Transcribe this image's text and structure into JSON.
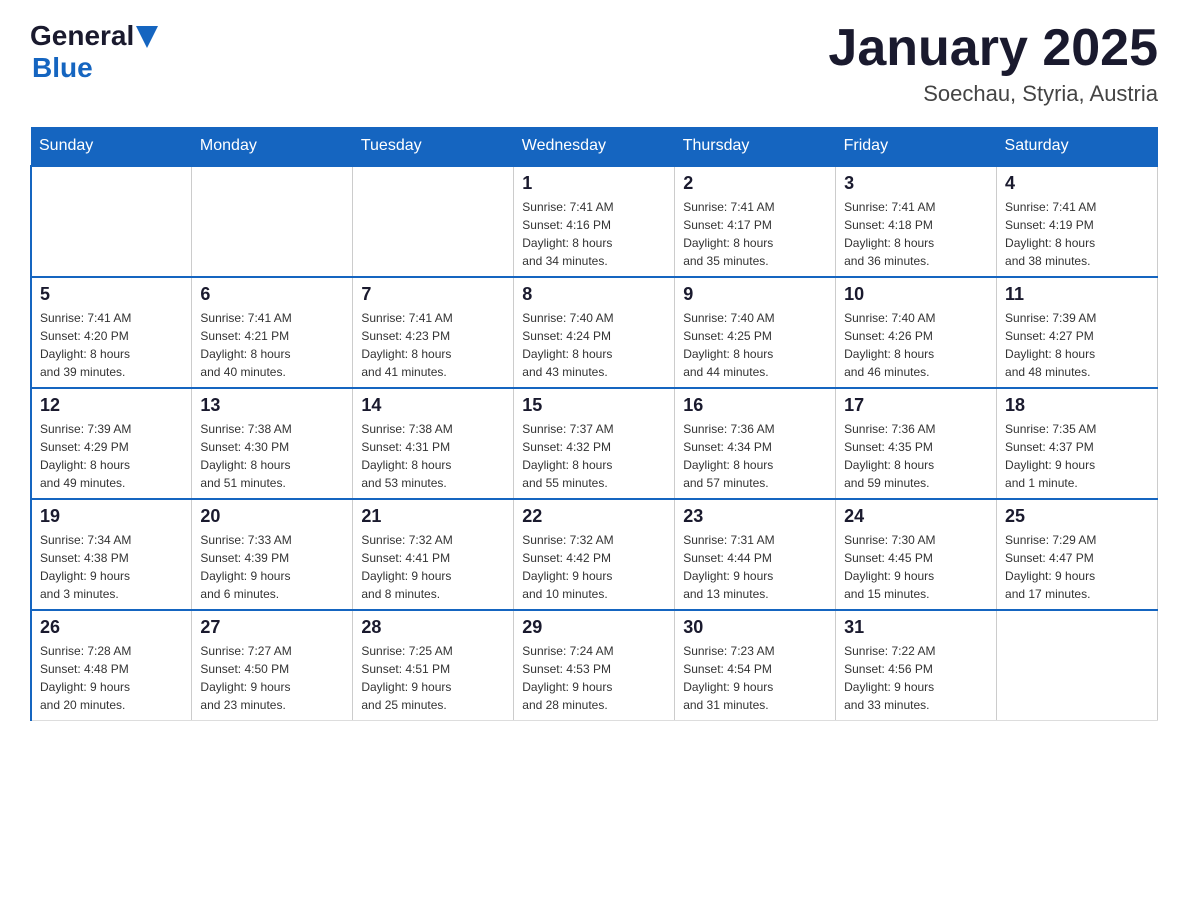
{
  "header": {
    "logo_general": "General",
    "logo_blue": "Blue",
    "title": "January 2025",
    "subtitle": "Soechau, Styria, Austria"
  },
  "days_of_week": [
    "Sunday",
    "Monday",
    "Tuesday",
    "Wednesday",
    "Thursday",
    "Friday",
    "Saturday"
  ],
  "weeks": [
    [
      {
        "day": "",
        "info": ""
      },
      {
        "day": "",
        "info": ""
      },
      {
        "day": "",
        "info": ""
      },
      {
        "day": "1",
        "info": "Sunrise: 7:41 AM\nSunset: 4:16 PM\nDaylight: 8 hours\nand 34 minutes."
      },
      {
        "day": "2",
        "info": "Sunrise: 7:41 AM\nSunset: 4:17 PM\nDaylight: 8 hours\nand 35 minutes."
      },
      {
        "day": "3",
        "info": "Sunrise: 7:41 AM\nSunset: 4:18 PM\nDaylight: 8 hours\nand 36 minutes."
      },
      {
        "day": "4",
        "info": "Sunrise: 7:41 AM\nSunset: 4:19 PM\nDaylight: 8 hours\nand 38 minutes."
      }
    ],
    [
      {
        "day": "5",
        "info": "Sunrise: 7:41 AM\nSunset: 4:20 PM\nDaylight: 8 hours\nand 39 minutes."
      },
      {
        "day": "6",
        "info": "Sunrise: 7:41 AM\nSunset: 4:21 PM\nDaylight: 8 hours\nand 40 minutes."
      },
      {
        "day": "7",
        "info": "Sunrise: 7:41 AM\nSunset: 4:23 PM\nDaylight: 8 hours\nand 41 minutes."
      },
      {
        "day": "8",
        "info": "Sunrise: 7:40 AM\nSunset: 4:24 PM\nDaylight: 8 hours\nand 43 minutes."
      },
      {
        "day": "9",
        "info": "Sunrise: 7:40 AM\nSunset: 4:25 PM\nDaylight: 8 hours\nand 44 minutes."
      },
      {
        "day": "10",
        "info": "Sunrise: 7:40 AM\nSunset: 4:26 PM\nDaylight: 8 hours\nand 46 minutes."
      },
      {
        "day": "11",
        "info": "Sunrise: 7:39 AM\nSunset: 4:27 PM\nDaylight: 8 hours\nand 48 minutes."
      }
    ],
    [
      {
        "day": "12",
        "info": "Sunrise: 7:39 AM\nSunset: 4:29 PM\nDaylight: 8 hours\nand 49 minutes."
      },
      {
        "day": "13",
        "info": "Sunrise: 7:38 AM\nSunset: 4:30 PM\nDaylight: 8 hours\nand 51 minutes."
      },
      {
        "day": "14",
        "info": "Sunrise: 7:38 AM\nSunset: 4:31 PM\nDaylight: 8 hours\nand 53 minutes."
      },
      {
        "day": "15",
        "info": "Sunrise: 7:37 AM\nSunset: 4:32 PM\nDaylight: 8 hours\nand 55 minutes."
      },
      {
        "day": "16",
        "info": "Sunrise: 7:36 AM\nSunset: 4:34 PM\nDaylight: 8 hours\nand 57 minutes."
      },
      {
        "day": "17",
        "info": "Sunrise: 7:36 AM\nSunset: 4:35 PM\nDaylight: 8 hours\nand 59 minutes."
      },
      {
        "day": "18",
        "info": "Sunrise: 7:35 AM\nSunset: 4:37 PM\nDaylight: 9 hours\nand 1 minute."
      }
    ],
    [
      {
        "day": "19",
        "info": "Sunrise: 7:34 AM\nSunset: 4:38 PM\nDaylight: 9 hours\nand 3 minutes."
      },
      {
        "day": "20",
        "info": "Sunrise: 7:33 AM\nSunset: 4:39 PM\nDaylight: 9 hours\nand 6 minutes."
      },
      {
        "day": "21",
        "info": "Sunrise: 7:32 AM\nSunset: 4:41 PM\nDaylight: 9 hours\nand 8 minutes."
      },
      {
        "day": "22",
        "info": "Sunrise: 7:32 AM\nSunset: 4:42 PM\nDaylight: 9 hours\nand 10 minutes."
      },
      {
        "day": "23",
        "info": "Sunrise: 7:31 AM\nSunset: 4:44 PM\nDaylight: 9 hours\nand 13 minutes."
      },
      {
        "day": "24",
        "info": "Sunrise: 7:30 AM\nSunset: 4:45 PM\nDaylight: 9 hours\nand 15 minutes."
      },
      {
        "day": "25",
        "info": "Sunrise: 7:29 AM\nSunset: 4:47 PM\nDaylight: 9 hours\nand 17 minutes."
      }
    ],
    [
      {
        "day": "26",
        "info": "Sunrise: 7:28 AM\nSunset: 4:48 PM\nDaylight: 9 hours\nand 20 minutes."
      },
      {
        "day": "27",
        "info": "Sunrise: 7:27 AM\nSunset: 4:50 PM\nDaylight: 9 hours\nand 23 minutes."
      },
      {
        "day": "28",
        "info": "Sunrise: 7:25 AM\nSunset: 4:51 PM\nDaylight: 9 hours\nand 25 minutes."
      },
      {
        "day": "29",
        "info": "Sunrise: 7:24 AM\nSunset: 4:53 PM\nDaylight: 9 hours\nand 28 minutes."
      },
      {
        "day": "30",
        "info": "Sunrise: 7:23 AM\nSunset: 4:54 PM\nDaylight: 9 hours\nand 31 minutes."
      },
      {
        "day": "31",
        "info": "Sunrise: 7:22 AM\nSunset: 4:56 PM\nDaylight: 9 hours\nand 33 minutes."
      },
      {
        "day": "",
        "info": ""
      }
    ]
  ]
}
